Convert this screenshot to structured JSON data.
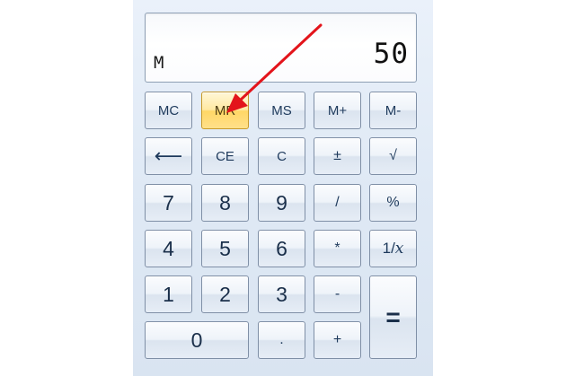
{
  "display": {
    "memory_indicator": "M",
    "value": "50"
  },
  "keys": {
    "mc": "MC",
    "mr": "MR",
    "ms": "MS",
    "m_plus": "M+",
    "m_minus": "M-",
    "backspace": "⟵",
    "ce": "CE",
    "c": "C",
    "plus_minus": "±",
    "sqrt": "√",
    "seven": "7",
    "eight": "8",
    "nine": "9",
    "divide": "/",
    "percent": "%",
    "four": "4",
    "five": "5",
    "six": "6",
    "multiply": "*",
    "reciprocal_prefix": "1/",
    "reciprocal_var": "x",
    "one": "1",
    "two": "2",
    "three": "3",
    "minus": "-",
    "equals": "=",
    "zero": "0",
    "decimal": ".",
    "plus": "+"
  },
  "colors": {
    "highlight_key": "#ffd766",
    "arrow": "#e3141b"
  }
}
